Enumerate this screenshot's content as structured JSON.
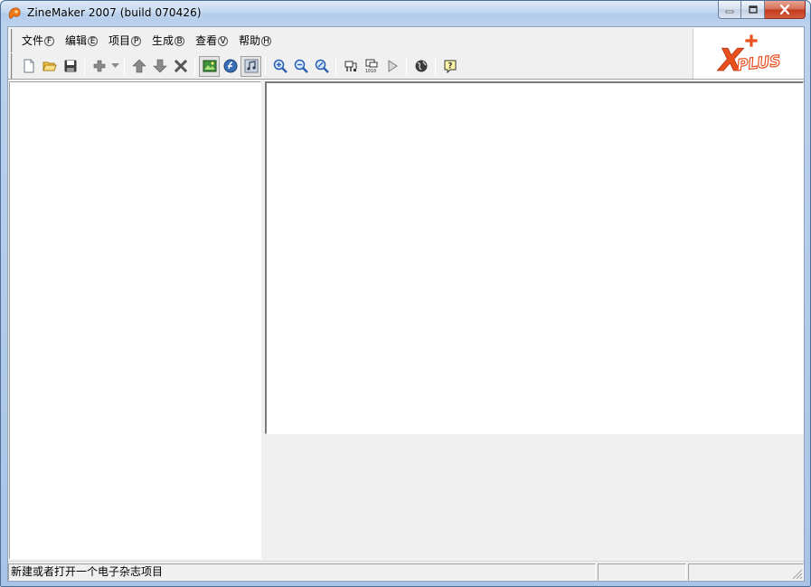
{
  "window": {
    "title": "ZineMaker 2007 (build 070426)"
  },
  "menu": {
    "items": [
      {
        "label": "文件",
        "key": "F"
      },
      {
        "label": "编辑",
        "key": "E"
      },
      {
        "label": "项目",
        "key": "P"
      },
      {
        "label": "生成",
        "key": "B"
      },
      {
        "label": "查看",
        "key": "V"
      },
      {
        "label": "帮助",
        "key": "H"
      }
    ]
  },
  "toolbar": {
    "icons": [
      "new-document-icon",
      "open-folder-icon",
      "save-icon",
      "add-icon",
      "dropdown-arrow-icon",
      "move-up-icon",
      "move-down-icon",
      "delete-icon",
      "image-icon",
      "flash-icon",
      "music-icon",
      "zoom-in-icon",
      "zoom-out-icon",
      "zoom-reset-icon",
      "build-icon",
      "compile-icon",
      "play-icon",
      "web-icon",
      "help-icon"
    ]
  },
  "logo": {
    "text": "XPLUS",
    "color": "#e8501e"
  },
  "statusbar": {
    "message": "新建或者打开一个电子杂志项目",
    "pane2": "",
    "pane3": ""
  }
}
